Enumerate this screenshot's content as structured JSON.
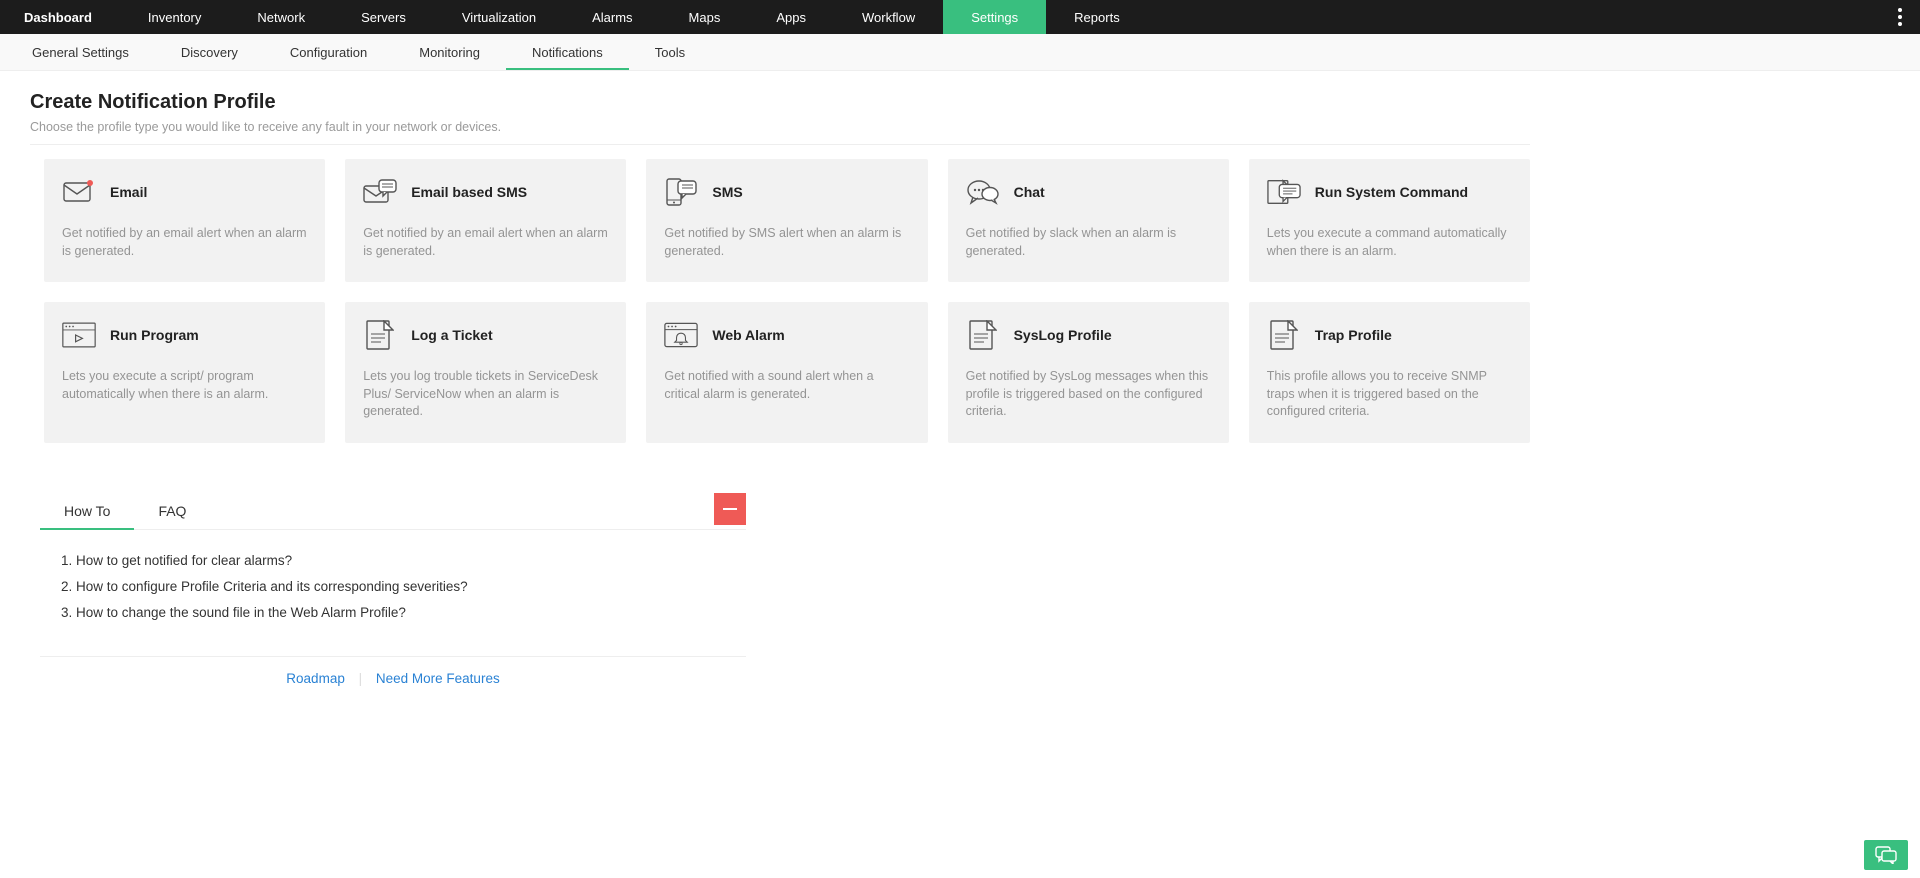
{
  "topnav": {
    "items": [
      "Dashboard",
      "Inventory",
      "Network",
      "Servers",
      "Virtualization",
      "Alarms",
      "Maps",
      "Apps",
      "Workflow",
      "Settings",
      "Reports"
    ],
    "active": "Settings"
  },
  "subnav": {
    "items": [
      "General Settings",
      "Discovery",
      "Configuration",
      "Monitoring",
      "Notifications",
      "Tools"
    ],
    "active": "Notifications"
  },
  "page": {
    "title": "Create Notification Profile",
    "subtitle": "Choose the profile type you would like to receive any fault in your network or devices."
  },
  "cards": [
    {
      "id": "email",
      "title": "Email",
      "desc": "Get notified by an email alert when an alarm is generated."
    },
    {
      "id": "email-sms",
      "title": "Email based SMS",
      "desc": "Get notified by an email alert when an alarm is generated."
    },
    {
      "id": "sms",
      "title": "SMS",
      "desc": "Get notified by SMS alert when an alarm is generated."
    },
    {
      "id": "chat",
      "title": "Chat",
      "desc": "Get notified by slack when an alarm is generated."
    },
    {
      "id": "run-cmd",
      "title": "Run System Command",
      "desc": "Lets you execute a command automatically when there is an alarm."
    },
    {
      "id": "run-program",
      "title": "Run Program",
      "desc": "Lets you execute a script/ program automatically when there is an alarm."
    },
    {
      "id": "log-ticket",
      "title": "Log a Ticket",
      "desc": "Lets you log trouble tickets in ServiceDesk Plus/ ServiceNow when an alarm is generated."
    },
    {
      "id": "web-alarm",
      "title": "Web Alarm",
      "desc": "Get notified with a sound alert when a critical alarm is generated."
    },
    {
      "id": "syslog",
      "title": "SysLog Profile",
      "desc": "Get notified by SysLog messages when this profile is triggered based on the configured criteria."
    },
    {
      "id": "trap",
      "title": "Trap Profile",
      "desc": "This profile allows you to receive SNMP traps when it is triggered based on the configured criteria."
    }
  ],
  "help": {
    "tabs": [
      "How To",
      "FAQ"
    ],
    "active": "How To",
    "howto": [
      "How to get notified for clear alarms?",
      "How to configure Profile Criteria and its corresponding severities?",
      "How to change the sound file in the Web Alarm Profile?"
    ],
    "links": {
      "roadmap": "Roadmap",
      "more": "Need More Features"
    }
  }
}
